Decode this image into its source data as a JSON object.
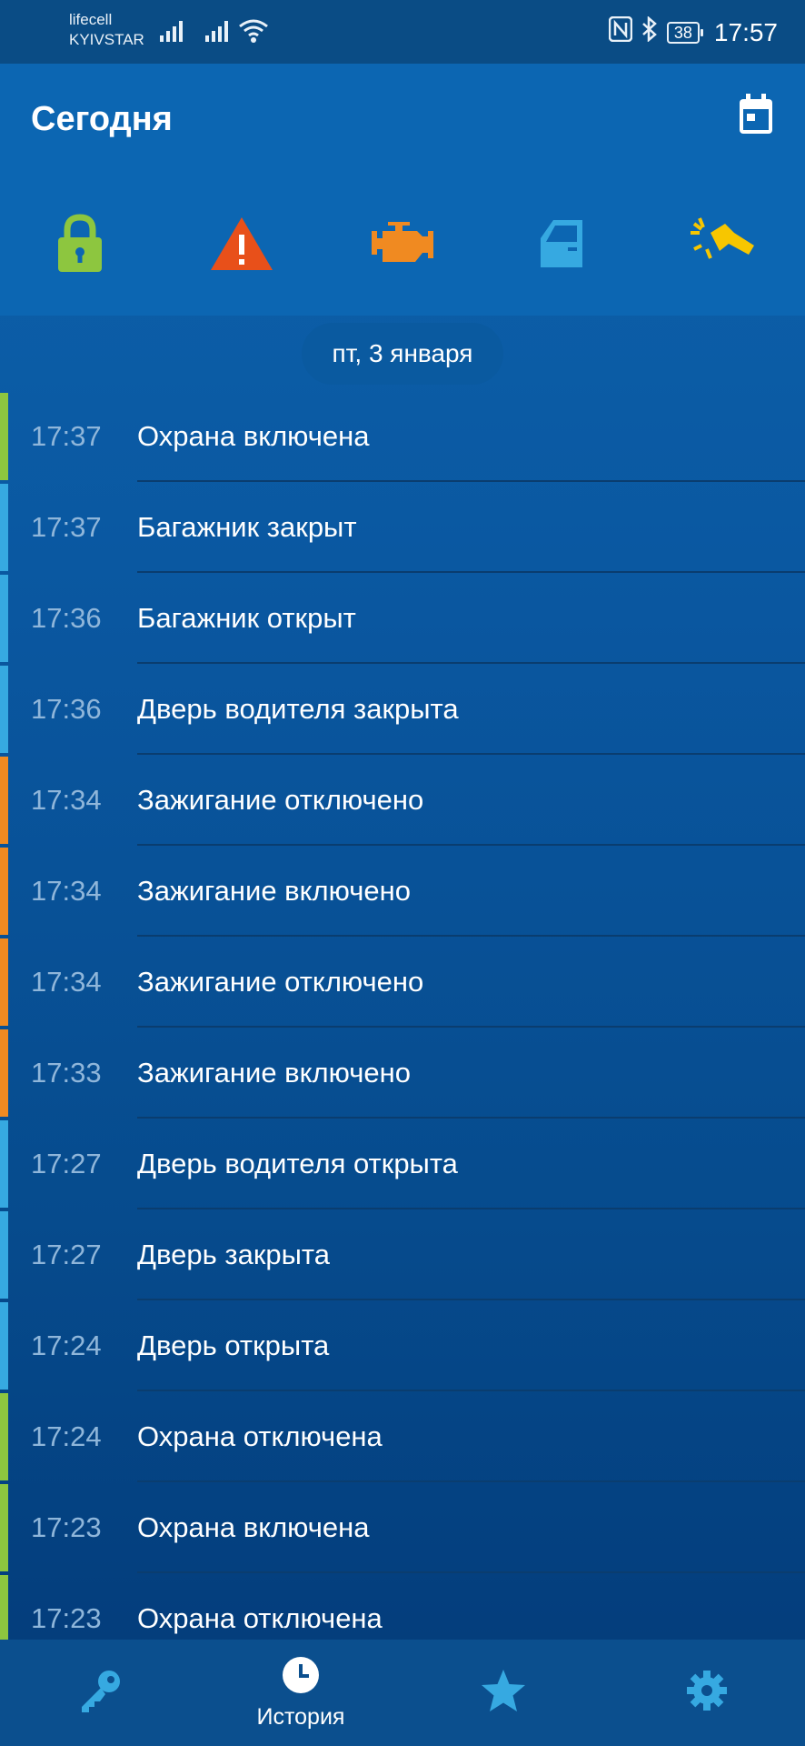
{
  "status_bar": {
    "carrier_1": "lifecell",
    "carrier_2": "KYIVSTAR",
    "battery": "38",
    "time": "17:57"
  },
  "header": {
    "title": "Сегодня"
  },
  "filters": [
    {
      "name": "lock",
      "color": "#8dc63f"
    },
    {
      "name": "warning",
      "color": "#e8501a"
    },
    {
      "name": "engine",
      "color": "#f08a21"
    },
    {
      "name": "door",
      "color": "#36a9e1"
    },
    {
      "name": "impact",
      "color": "#f7c600"
    }
  ],
  "date_chip": "пт, 3 января",
  "events": [
    {
      "time": "17:37",
      "text": "Охрана включена",
      "color": "#8dc63f"
    },
    {
      "time": "17:37",
      "text": "Багажник закрыт",
      "color": "#36a9e1"
    },
    {
      "time": "17:36",
      "text": "Багажник открыт",
      "color": "#36a9e1"
    },
    {
      "time": "17:36",
      "text": "Дверь водителя закрыта",
      "color": "#36a9e1"
    },
    {
      "time": "17:34",
      "text": "Зажигание отключено",
      "color": "#f08a21"
    },
    {
      "time": "17:34",
      "text": "Зажигание включено",
      "color": "#f08a21"
    },
    {
      "time": "17:34",
      "text": "Зажигание отключено",
      "color": "#f08a21"
    },
    {
      "time": "17:33",
      "text": "Зажигание включено",
      "color": "#f08a21"
    },
    {
      "time": "17:27",
      "text": "Дверь водителя открыта",
      "color": "#36a9e1"
    },
    {
      "time": "17:27",
      "text": "Дверь закрыта",
      "color": "#36a9e1"
    },
    {
      "time": "17:24",
      "text": "Дверь открыта",
      "color": "#36a9e1"
    },
    {
      "time": "17:24",
      "text": "Охрана отключена",
      "color": "#8dc63f"
    },
    {
      "time": "17:23",
      "text": "Охрана включена",
      "color": "#8dc63f"
    },
    {
      "time": "17:23",
      "text": "Охрана отключена",
      "color": "#8dc63f"
    }
  ],
  "bottom_nav": {
    "history_label": "История",
    "accent": "#36a9e1"
  }
}
